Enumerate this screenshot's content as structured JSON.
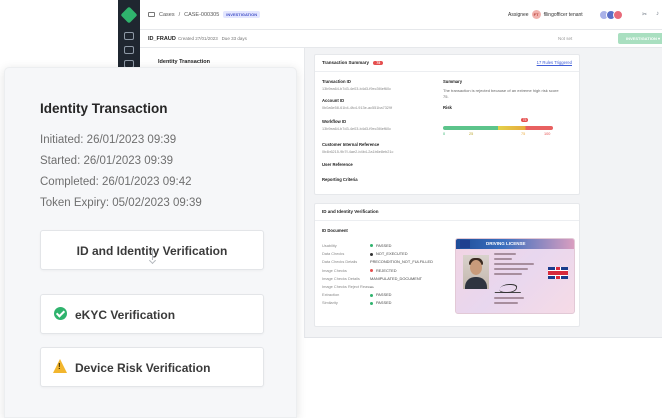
{
  "app": {
    "breadcrumb": {
      "section": "Cases",
      "separator": "/",
      "case_code": "CASE-000305",
      "status_tag": "INVESTIGATION"
    },
    "case": {
      "id": "ID_FRAUD",
      "created_label": "Created 27/01/2023",
      "due_label": "Due 33 days"
    },
    "assignee": {
      "label": "Assignee",
      "initials": "FT",
      "name": "fllingofficer tenant"
    },
    "not_set": "Not set",
    "investigation_button": "INVESTIGATION",
    "left_panel_title": "Identity Transaction",
    "icons": [
      "scissors-icon",
      "bell-icon",
      "link-icon"
    ]
  },
  "summary_card": {
    "title": "Transaction Summary",
    "risk_badge": "75",
    "rules_link": "17 Rules Triggered",
    "transaction_id": {
      "label": "Transaction ID",
      "value": "13b9ea64-b7d3-4e03-b4d3-f9ec3f4ef60c"
    },
    "account_id": {
      "label": "Account ID",
      "value": "0b0a6e58-61b4-4fc4-913e-ac551ba7329f"
    },
    "workflow_id": {
      "label": "Workflow ID",
      "value": "13b9ea64-b7d3-4e03-b4d3-f9ec3f4ef60c"
    },
    "customer_ref": {
      "label": "Customer Internal Reference",
      "value": "0b4b6215-9b7f-4ae2-b4b4-2a1b6e8eb21c"
    },
    "user_ref": {
      "label": "User Reference"
    },
    "reporting": {
      "label": "Reporting Criteria"
    },
    "summary_label": "Summary",
    "summary_text": "The transaction is rejected because of an extreme high risk score 75.",
    "risk_label": "Risk",
    "risk": {
      "value": 75,
      "marker": "75",
      "ticks": [
        "0",
        "25",
        "75",
        "100"
      ]
    }
  },
  "idv_card": {
    "title": "ID and Identity Verification",
    "section": "ID Document",
    "rows": [
      {
        "key": "Usability",
        "value": "PASSED",
        "status": "ok"
      },
      {
        "key": "Data Checks",
        "value": "NOT_EXECUTED",
        "status": "neutral"
      },
      {
        "key": "Data Checks Details",
        "value": "PRECONDITION_NOT_FULFILLED",
        "status": "none"
      },
      {
        "key": "Image Checks",
        "value": "REJECTED",
        "status": "bad"
      },
      {
        "key": "Image Checks Details",
        "value": "MANIPULATED_DOCUMENT",
        "status": "none"
      },
      {
        "key": "Image Checks Reject Reason",
        "value": "—",
        "status": "none"
      },
      {
        "key": "Extraction",
        "value": "PASSED",
        "status": "ok"
      },
      {
        "key": "Similarity",
        "value": "PASSED",
        "status": "ok"
      }
    ],
    "license_title": "DRIVING LICENSE"
  },
  "overlay": {
    "title": "Identity Transaction",
    "initiated": "Initiated: 26/01/2023 09:39",
    "started": "Started: 26/01/2023 09:39",
    "completed": "Completed: 26/01/2023 09:42",
    "token_expiry": "Token Expiry: 05/02/2023 09:39",
    "steps": {
      "idv": "ID and Identity Verification",
      "ekyc": "eKYC Verification",
      "device": "Device Risk Verification"
    }
  },
  "colors": {
    "success": "#2fb36d",
    "danger": "#e54e4e",
    "warning": "#f2b62e",
    "link": "#3d5bd6",
    "rail": "#1f2630"
  }
}
